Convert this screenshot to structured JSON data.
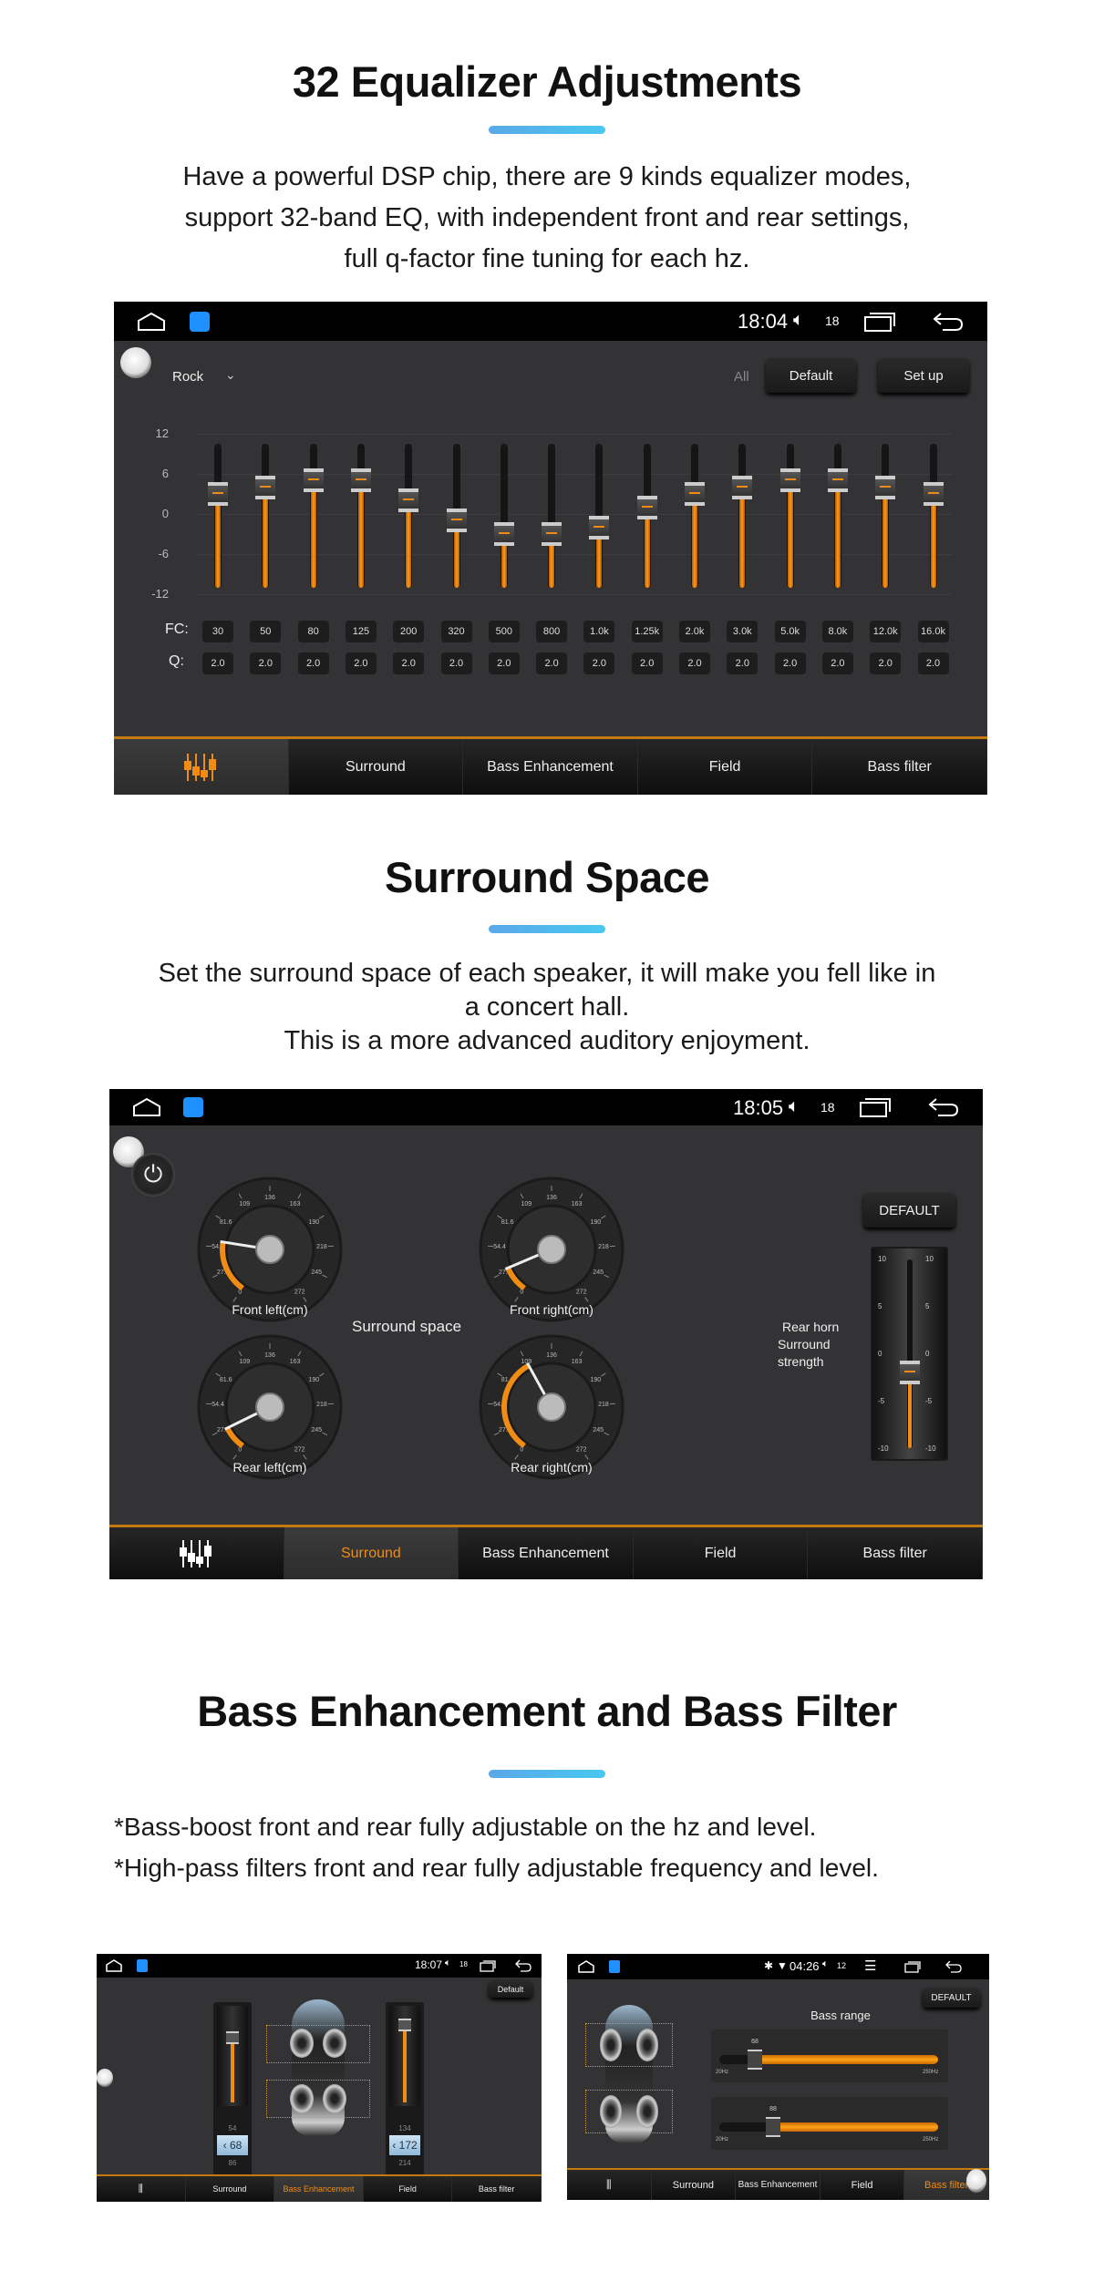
{
  "section1": {
    "title": "32 Equalizer Adjustments",
    "lines": [
      "Have a powerful DSP chip, there are 9 kinds equalizer modes,",
      "support 32-band EQ, with independent front and rear settings,",
      "full q-factor fine tuning for each hz."
    ]
  },
  "section2": {
    "title": "Surround Space",
    "lines": [
      "Set the surround space of each speaker, it will make you fell like in",
      "a concert hall.",
      "This is a more advanced auditory enjoyment."
    ]
  },
  "section3": {
    "title": "Bass Enhancement and Bass Filter",
    "lines": [
      "*Bass-boost front and rear fully adjustable on the hz and level.",
      "*High-pass filters front and rear fully adjustable frequency and level."
    ]
  },
  "colors": {
    "accent": "#f08c14",
    "title_bar": "#4ab8ee",
    "panel_bg": "#333335"
  },
  "tabs": [
    "Surround",
    "Bass Enhancement",
    "Field",
    "Bass filter"
  ],
  "eq_panel": {
    "status": {
      "time": "18:04",
      "volume": "18",
      "icons": [
        "home-icon",
        "dsp-app-icon",
        "volume-icon",
        "recent-apps-icon",
        "back-icon"
      ]
    },
    "preset": "Rock",
    "all_label": "All",
    "default_label": "Default",
    "setup_label": "Set up",
    "y_ticks": [
      "12",
      "6",
      "0",
      "-6",
      "-12"
    ],
    "y_range": [
      -12,
      12
    ],
    "fc_label": "FC:",
    "q_label": "Q:",
    "bands": [
      {
        "fc": "30",
        "q": "2.0",
        "gain": 3
      },
      {
        "fc": "50",
        "q": "2.0",
        "gain": 4
      },
      {
        "fc": "80",
        "q": "2.0",
        "gain": 5
      },
      {
        "fc": "125",
        "q": "2.0",
        "gain": 5
      },
      {
        "fc": "200",
        "q": "2.0",
        "gain": 2
      },
      {
        "fc": "320",
        "q": "2.0",
        "gain": -1
      },
      {
        "fc": "500",
        "q": "2.0",
        "gain": -3
      },
      {
        "fc": "800",
        "q": "2.0",
        "gain": -3
      },
      {
        "fc": "1.0k",
        "q": "2.0",
        "gain": -2
      },
      {
        "fc": "1.25k",
        "q": "2.0",
        "gain": 1
      },
      {
        "fc": "2.0k",
        "q": "2.0",
        "gain": 3
      },
      {
        "fc": "3.0k",
        "q": "2.0",
        "gain": 4
      },
      {
        "fc": "5.0k",
        "q": "2.0",
        "gain": 5
      },
      {
        "fc": "8.0k",
        "q": "2.0",
        "gain": 5
      },
      {
        "fc": "12.0k",
        "q": "2.0",
        "gain": 4
      },
      {
        "fc": "16.0k",
        "q": "2.0",
        "gain": 3
      }
    ]
  },
  "surround_panel": {
    "status": {
      "time": "18:05",
      "volume": "18"
    },
    "center_label": "Surround space",
    "default_label": "DEFAULT",
    "rear_label": [
      "Rear horn",
      "Surround",
      "strength"
    ],
    "gauge_ticks": [
      "0",
      "27.2",
      "54.4",
      "81.6",
      "109",
      "136",
      "163",
      "190",
      "218",
      "245",
      "272"
    ],
    "gauge_range": [
      0,
      272
    ],
    "gauges": [
      {
        "label": "Front left(cm)",
        "value": 60
      },
      {
        "label": "Front right(cm)",
        "value": 30
      },
      {
        "label": "Rear left(cm)",
        "value": 27
      },
      {
        "label": "Rear right(cm)",
        "value": 109
      }
    ],
    "strength": {
      "value": -2,
      "range": [
        -10,
        10
      ],
      "ticks": [
        "10",
        "5",
        "0",
        "-5",
        "-10"
      ]
    }
  },
  "bass_enh_panel": {
    "status": {
      "time": "18:07",
      "volume": "18"
    },
    "default_label": "Default",
    "left_value": "68",
    "left_prev": "54",
    "left_next": "86",
    "right_value": "172",
    "right_prev": "134",
    "right_next": "214",
    "left_level": 0.45,
    "right_level": 0.75
  },
  "bass_filter_panel": {
    "status": {
      "time": "04:26",
      "volume": "12"
    },
    "default_label": "DEFAULT",
    "title": "Bass range",
    "sliders": [
      {
        "value": "68",
        "min": "20Hz",
        "max": "250Hz"
      },
      {
        "value": "88",
        "min": "20Hz",
        "max": "250Hz"
      }
    ],
    "tabs": [
      "Surround",
      "Bass Enhancement",
      "Field",
      "Bass filter"
    ]
  }
}
